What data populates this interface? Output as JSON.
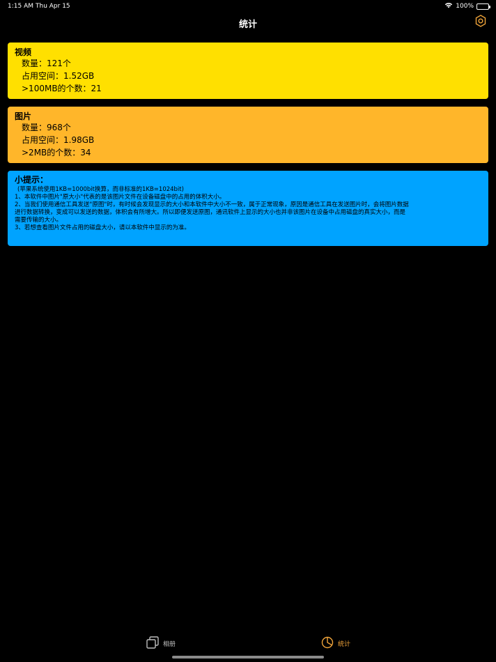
{
  "status_bar": {
    "time": "1:15 AM",
    "date": "Thu Apr 15",
    "battery": "100%"
  },
  "header": {
    "title": "统计"
  },
  "video_card": {
    "title": "视频",
    "count": "数量：121个",
    "storage": "占用空间：1.52GB",
    "large": ">100MB的个数：21",
    "color": "#FFE000"
  },
  "image_card": {
    "title": "图片",
    "count": "数量：968个",
    "storage": "占用空间：1.98GB",
    "large": ">2MB的个数：34",
    "color": "#FFB62A"
  },
  "tips_card": {
    "title": "小提示：",
    "note": "(苹果系统使用1KB=1000bit换算，而非标准的1KB=1024bit)",
    "line1": "1、本软件中图片\"原大小\"代表的是该图片文件在设备磁盘中的占用的体积大小。",
    "line2a": "2、当我们使用通信工具发送\"原图\"时，有时候会发现显示的大小和本软件中大小不一致，属于正常现象，原因是通信工具在发送图片时，会将图片数据",
    "line2b": "进行数据转换，变成可以发送的数据，体积会有所增大。所以即便发送原图，通讯软件上显示的大小也并非该图片在设备中占用磁盘的真实大小，而是",
    "line2c": "需要传输的大小。",
    "line3": "3、若想查看图片文件占用的磁盘大小，请以本软件中显示的为准。",
    "color": "#00A3FF"
  },
  "tab_bar": {
    "album_label": "相册",
    "stats_label": "统计",
    "active_color": "#F0A43A"
  }
}
